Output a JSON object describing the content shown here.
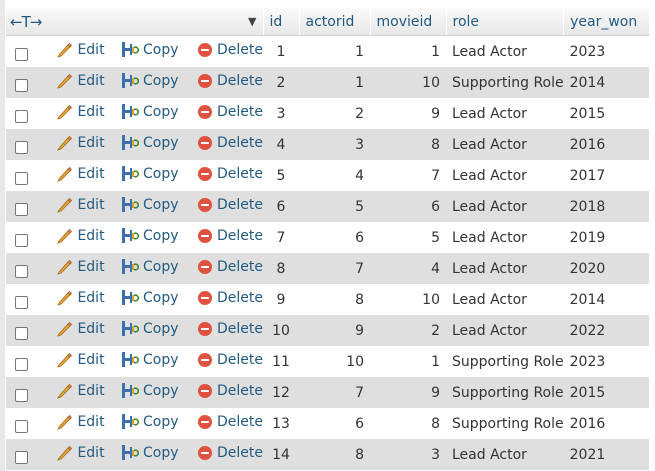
{
  "header": {
    "columns": [
      "id",
      "actorid",
      "movieid",
      "role",
      "year_won"
    ],
    "arrows_glyph": "←T→",
    "caret_glyph": "▼"
  },
  "actions": {
    "edit_label": "Edit",
    "copy_label": "Copy",
    "delete_label": "Delete"
  },
  "rows": [
    {
      "id": "1",
      "actorid": "1",
      "movieid": "1",
      "role": "Lead Actor",
      "year_won": "2023"
    },
    {
      "id": "2",
      "actorid": "1",
      "movieid": "10",
      "role": "Supporting Role",
      "year_won": "2014"
    },
    {
      "id": "3",
      "actorid": "2",
      "movieid": "9",
      "role": "Lead Actor",
      "year_won": "2015"
    },
    {
      "id": "4",
      "actorid": "3",
      "movieid": "8",
      "role": "Lead Actor",
      "year_won": "2016"
    },
    {
      "id": "5",
      "actorid": "4",
      "movieid": "7",
      "role": "Lead Actor",
      "year_won": "2017"
    },
    {
      "id": "6",
      "actorid": "5",
      "movieid": "6",
      "role": "Lead Actor",
      "year_won": "2018"
    },
    {
      "id": "7",
      "actorid": "6",
      "movieid": "5",
      "role": "Lead Actor",
      "year_won": "2019"
    },
    {
      "id": "8",
      "actorid": "7",
      "movieid": "4",
      "role": "Lead Actor",
      "year_won": "2020"
    },
    {
      "id": "9",
      "actorid": "8",
      "movieid": "10",
      "role": "Lead Actor",
      "year_won": "2014"
    },
    {
      "id": "10",
      "actorid": "9",
      "movieid": "2",
      "role": "Lead Actor",
      "year_won": "2022"
    },
    {
      "id": "11",
      "actorid": "10",
      "movieid": "1",
      "role": "Supporting Role",
      "year_won": "2023"
    },
    {
      "id": "12",
      "actorid": "7",
      "movieid": "9",
      "role": "Supporting Role",
      "year_won": "2015"
    },
    {
      "id": "13",
      "actorid": "6",
      "movieid": "8",
      "role": "Supporting Role",
      "year_won": "2016"
    },
    {
      "id": "14",
      "actorid": "8",
      "movieid": "3",
      "role": "Lead Actor",
      "year_won": "2021"
    }
  ],
  "colors": {
    "link": "#235a81",
    "row_alt": "#dfdfdf",
    "delete_icon": "#e0523f",
    "pencil_icon": "#e8a63a"
  }
}
